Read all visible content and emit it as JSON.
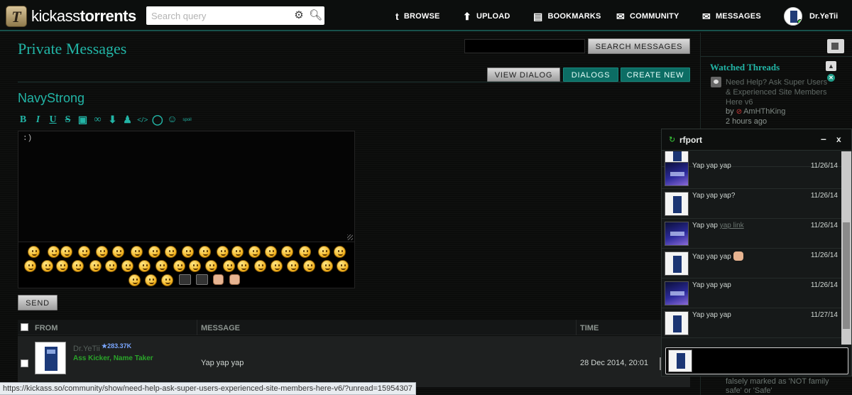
{
  "header": {
    "logo_letter": "T",
    "logo_prefix": "kickass",
    "logo_suffix": "torrents",
    "search_placeholder": "Search query",
    "nav": [
      {
        "label": "BROWSE",
        "icon": "tumblr-t-icon"
      },
      {
        "label": "UPLOAD",
        "icon": "upload-arrow-icon"
      },
      {
        "label": "BOOKMARKS",
        "icon": "bookmark-icon"
      },
      {
        "label": "COMMUNITY",
        "icon": "speech-bubbles-icon"
      },
      {
        "label": "MESSAGES",
        "icon": "envelope-icon"
      }
    ],
    "username": "Dr.YeTii"
  },
  "main": {
    "title": "Private Messages",
    "search_button": "SEARCH MESSAGES",
    "tabs": [
      "VIEW DIALOG",
      "DIALOGS",
      "CREATE NEW"
    ],
    "recipient": "NavyStrong",
    "editor_value": ":)",
    "send_label": "SEND",
    "columns": [
      "FROM",
      "MESSAGE",
      "TIME"
    ],
    "row": {
      "from": "Dr.YeTii",
      "reputation": "283.37K",
      "user_title": "Ass Kicker, Name Taker",
      "message": "Yap yap yap",
      "time": "28 Dec 2014, 20:01"
    }
  },
  "sidebar": {
    "watched_title": "Watched Threads",
    "thread_link": "Need Help? Ask Super Users & Experienced Site Members Here v6",
    "by_label": "by",
    "thread_user": "AmHThKing",
    "thread_ago": "2 hours ago",
    "more_text": "falsely marked as 'NOT family safe' or 'Safe'"
  },
  "chat": {
    "title": "rfport",
    "min_label": "–",
    "close_label": "x",
    "messages": [
      {
        "text": "Yap yap yap",
        "date": "11/26/14",
        "avatar": "space"
      },
      {
        "text": "Yap yap yap?",
        "date": "11/26/14",
        "avatar": "tardis"
      },
      {
        "text": "Yap yap",
        "link": "yap link",
        "date": "11/26/14",
        "avatar": "space"
      },
      {
        "text": "Yap yap yap",
        "date": "11/26/14",
        "avatar": "tardis"
      },
      {
        "text": "Yap yap yap",
        "date": "11/26/14",
        "avatar": "space"
      },
      {
        "text": "Yap yap yap",
        "date": "11/27/14",
        "avatar": "tardis"
      }
    ]
  },
  "statusbar": "https://kickass.so/community/show/need-help-ask-super-users-experienced-site-members-here-v6/?unread=15954307"
}
